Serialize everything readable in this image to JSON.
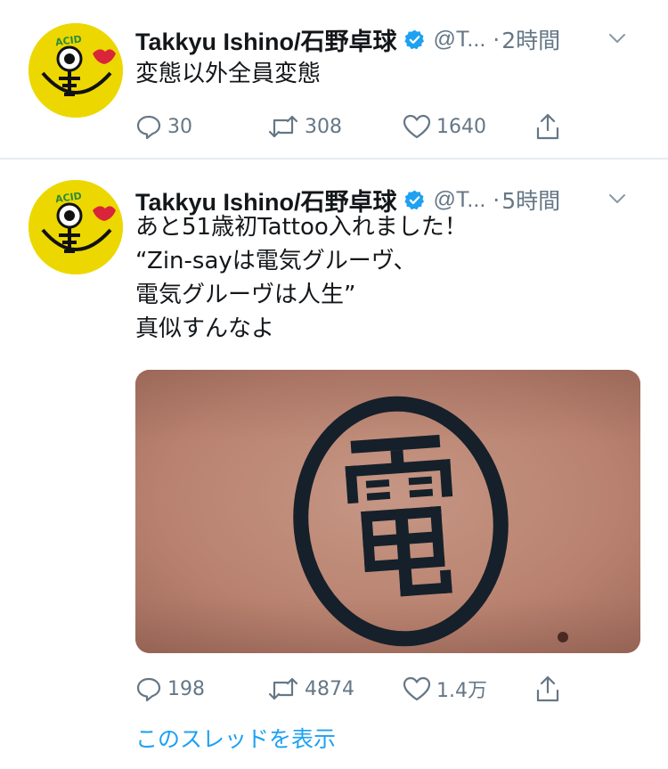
{
  "tweets": [
    {
      "display_name": "Takkyu Ishino/石野卓球",
      "handle": "@T...",
      "separator": "·",
      "time": "2時間",
      "lines": [
        "変態以外全員変態"
      ],
      "replies": "30",
      "retweets": "308",
      "likes": "1640"
    },
    {
      "display_name": "Takkyu Ishino/石野卓球",
      "handle": "@T...",
      "separator": "·",
      "time": "5時間",
      "lines": [
        "あと51歳初Tattoo入れました！",
        "“Zin-sayは電気グルーヴ、",
        "電気グルーヴは人生”",
        "真似すんなよ"
      ],
      "replies": "198",
      "retweets": "4874",
      "likes": "1.4万",
      "thread_link": "このスレッドを表示"
    }
  ],
  "avatar_text": "ACID",
  "icons": {
    "avatar": "acid-smiley-avatar",
    "verified": "verified-badge-icon",
    "chevron": "chevron-down-icon",
    "reply": "reply-icon",
    "retweet": "retweet-icon",
    "like": "heart-icon",
    "share": "share-icon"
  },
  "colors": {
    "accent": "#1da1f2",
    "secondary_text": "#657786",
    "primary_text": "#14171a",
    "divider": "#e6ecf0",
    "avatar_yellow": "#ecd800"
  }
}
